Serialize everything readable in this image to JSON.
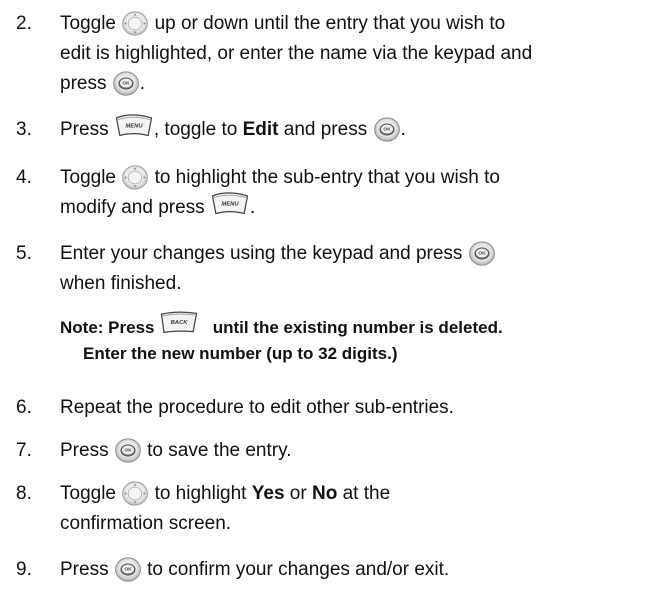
{
  "steps": [
    {
      "number": "2.",
      "line1_a": "Toggle",
      "line1_b": "up or down until the entry that you wish to",
      "line2": "edit is highlighted, or enter the name via the keypad and",
      "line3_a": "press",
      "line3_b": "."
    },
    {
      "number": "3.",
      "a": "Press",
      "b": ", toggle to",
      "bold": "Edit",
      "c": "and press",
      "d": "."
    },
    {
      "number": "4.",
      "line1_a": "Toggle",
      "line1_b": "to highlight the sub-entry that you wish to",
      "line2_a": "modify and press",
      "line2_b": "."
    },
    {
      "number": "5.",
      "line1": "Enter your changes using the keypad and press",
      "line2": "when finished."
    },
    {
      "number": "6.",
      "text": "Repeat the procedure to edit other sub-entries."
    },
    {
      "number": "7.",
      "a": "Press",
      "b": "to save the entry."
    },
    {
      "number": "8.",
      "line1_a": "Toggle",
      "line1_b": "to highlight",
      "line1_bold1": "Yes",
      "line1_or": "or",
      "line1_bold2": "No",
      "line1_c": "at the",
      "line2": "confirmation screen."
    },
    {
      "number": "9.",
      "a": "Press",
      "b": "to confirm your changes and/or exit."
    }
  ],
  "note": {
    "line1_a": "Note: Press",
    "line1_b": "until the existing number is deleted.",
    "line2": "Enter the new number (up to 32 digits.)"
  },
  "icons": {
    "ok_label": "OK",
    "menu_label": "MENU",
    "back_label": "BACK"
  },
  "colors": {
    "text": "#111111",
    "icon_fill": "#d9d9d9",
    "icon_stroke": "#555555"
  }
}
